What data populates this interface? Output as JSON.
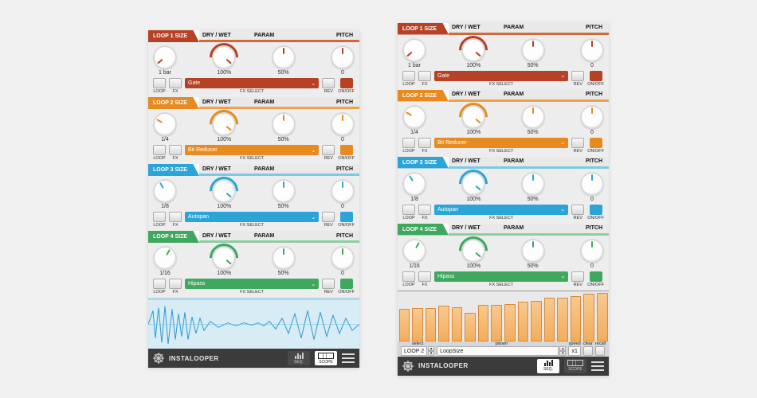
{
  "brand": "INSTALOOPER",
  "footer": {
    "seq_label": "SEQ.",
    "scope_label": "SCOPE"
  },
  "column_headers": {
    "drywet": "DRY / WET",
    "param": "PARAM",
    "pitch": "PITCH"
  },
  "labels": {
    "loop": "LOOP",
    "fx": "FX",
    "fxselect": "FX SELECT",
    "rev": "REV",
    "onoff": "ON/OFF"
  },
  "loops": [
    {
      "title": "LOOP 1 SIZE",
      "accent": "#b54224",
      "accent_mid": "#d06a3a",
      "size": "1 bar",
      "dry": "100%",
      "param": "50%",
      "pitch": "0",
      "fx": "Gate"
    },
    {
      "title": "LOOP 2 SIZE",
      "accent": "#e78a1f",
      "accent_mid": "#efa24a",
      "size": "1/4",
      "dry": "100%",
      "param": "50%",
      "pitch": "0",
      "fx": "Bit Reducer"
    },
    {
      "title": "LOOP 3 SIZE",
      "accent": "#2ca4d7",
      "accent_mid": "#7cc9e6",
      "size": "1/8",
      "dry": "100%",
      "param": "50%",
      "pitch": "0",
      "fx": "Autopan"
    },
    {
      "title": "LOOP 4 SIZE",
      "accent": "#3fa85e",
      "accent_mid": "#8ccf9f",
      "size": "1/16",
      "dry": "100%",
      "param": "50%",
      "pitch": "0",
      "fx": "Hipass"
    }
  ],
  "seq_controls": {
    "select_label": "select",
    "select_value": "LOOP 2",
    "param_label": "param",
    "param_value": "LoopSize",
    "speed_label": "speed",
    "speed_value": "x1",
    "clear_label": "clear",
    "recall_label": "recall"
  },
  "seq_bars": [
    64,
    66,
    66,
    70,
    68,
    56,
    72,
    72,
    74,
    78,
    80,
    86,
    86,
    90,
    94,
    96
  ],
  "panel_left_mode": "scope",
  "panel_right_mode": "seq"
}
